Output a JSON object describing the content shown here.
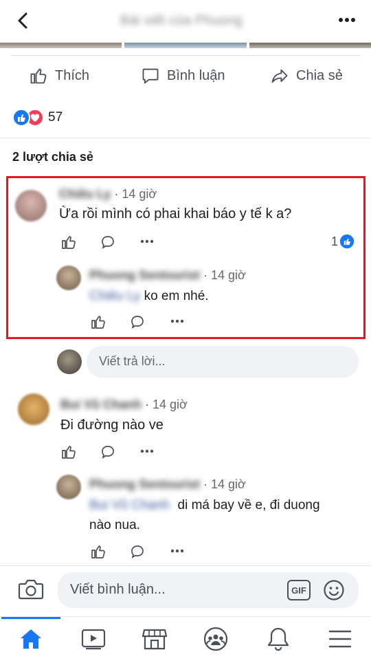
{
  "header": {
    "title": "Bài viết của Phuong",
    "back_icon": "back-arrow-icon",
    "more_icon": "more-horizontal-icon"
  },
  "actions": {
    "like_label": "Thích",
    "comment_label": "Bình luận",
    "share_label": "Chia sẻ"
  },
  "reactions": {
    "count": "57",
    "icons": [
      "like-reaction-icon",
      "love-reaction-icon"
    ]
  },
  "shares": {
    "label": "2 lượt chia sẻ"
  },
  "comments": [
    {
      "author": "Chiêu Ly",
      "time": "· 14 giờ",
      "text": "Ừa rồi mình có phai khai báo y tế k a?",
      "like_count": "1",
      "replies": [
        {
          "author": "Phuong Sentourist",
          "time": "· 14 giờ",
          "mention": "Chiêu Ly",
          "text": "ko em nhé."
        }
      ]
    },
    {
      "author": "Bui Vũ Chanh",
      "time": "· 14 giờ",
      "text": "Đi đường nào ve",
      "replies": [
        {
          "author": "Phuong Sentourist",
          "time": "· 14 giờ",
          "mention": "Bui Vũ Chanh",
          "text": "di má bay về e, đi duong",
          "text2": "nào nua."
        }
      ]
    }
  ],
  "reply_box": {
    "placeholder": "Viết trả lời..."
  },
  "comment_box": {
    "placeholder": "Viết bình luận...",
    "gif_label": "GIF"
  },
  "bottom_nav": [
    "home-icon",
    "watch-icon",
    "marketplace-icon",
    "groups-icon",
    "notifications-icon",
    "menu-icon"
  ],
  "colors": {
    "accent": "#1877f2",
    "highlight_border": "#e01a22",
    "like_blue": "#1877f2",
    "love_red": "#f33e58"
  }
}
